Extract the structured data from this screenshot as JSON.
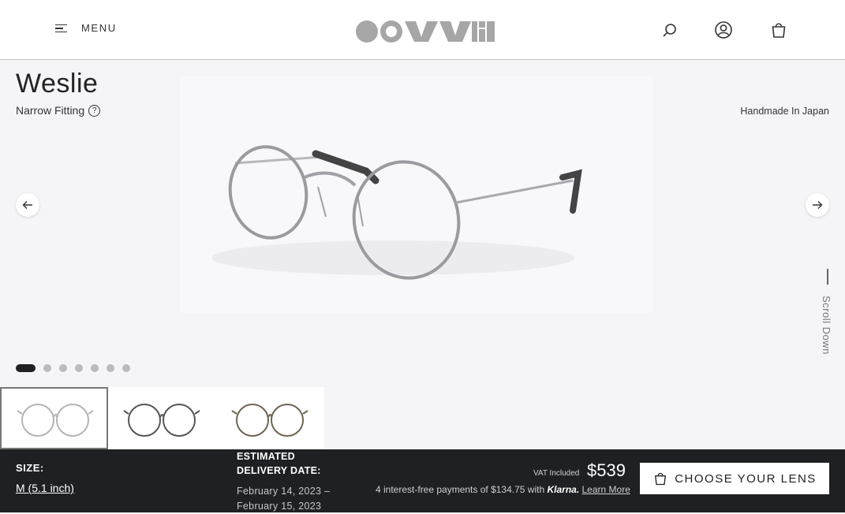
{
  "header": {
    "menu_label": "MENU",
    "logo_icon": "brand-logo",
    "search_icon": "search-icon",
    "account_icon": "account-icon",
    "cart_icon": "bag-icon"
  },
  "product": {
    "name": "Weslie",
    "fitting": "Narrow Fitting",
    "help_glyph": "?",
    "origin": "Handmade In Japan",
    "scroll_hint": "Scroll Down",
    "carousel_count": 7,
    "carousel_active": 1
  },
  "thumbnails": [
    {
      "variant": "silver",
      "selected": true
    },
    {
      "variant": "gunmetal",
      "selected": false
    },
    {
      "variant": "gold",
      "selected": false
    }
  ],
  "purchase": {
    "size_label": "SIZE:",
    "size_value": "M (5.1 inch)",
    "delivery_label": "ESTIMATED DELIVERY DATE:",
    "delivery_range": "February 14, 2023 – February 15, 2023",
    "vat_note": "VAT Included",
    "price": "$539",
    "installments": "4 interest-free payments of $134.75 with",
    "klarna": "Klarna.",
    "learn_more": "Learn More",
    "cta_label": "CHOOSE YOUR LENS"
  },
  "colors": {
    "bar_bg": "#1f2024",
    "stage_bg": "#f5f5f7",
    "logo_gray": "#a6a6a6"
  }
}
